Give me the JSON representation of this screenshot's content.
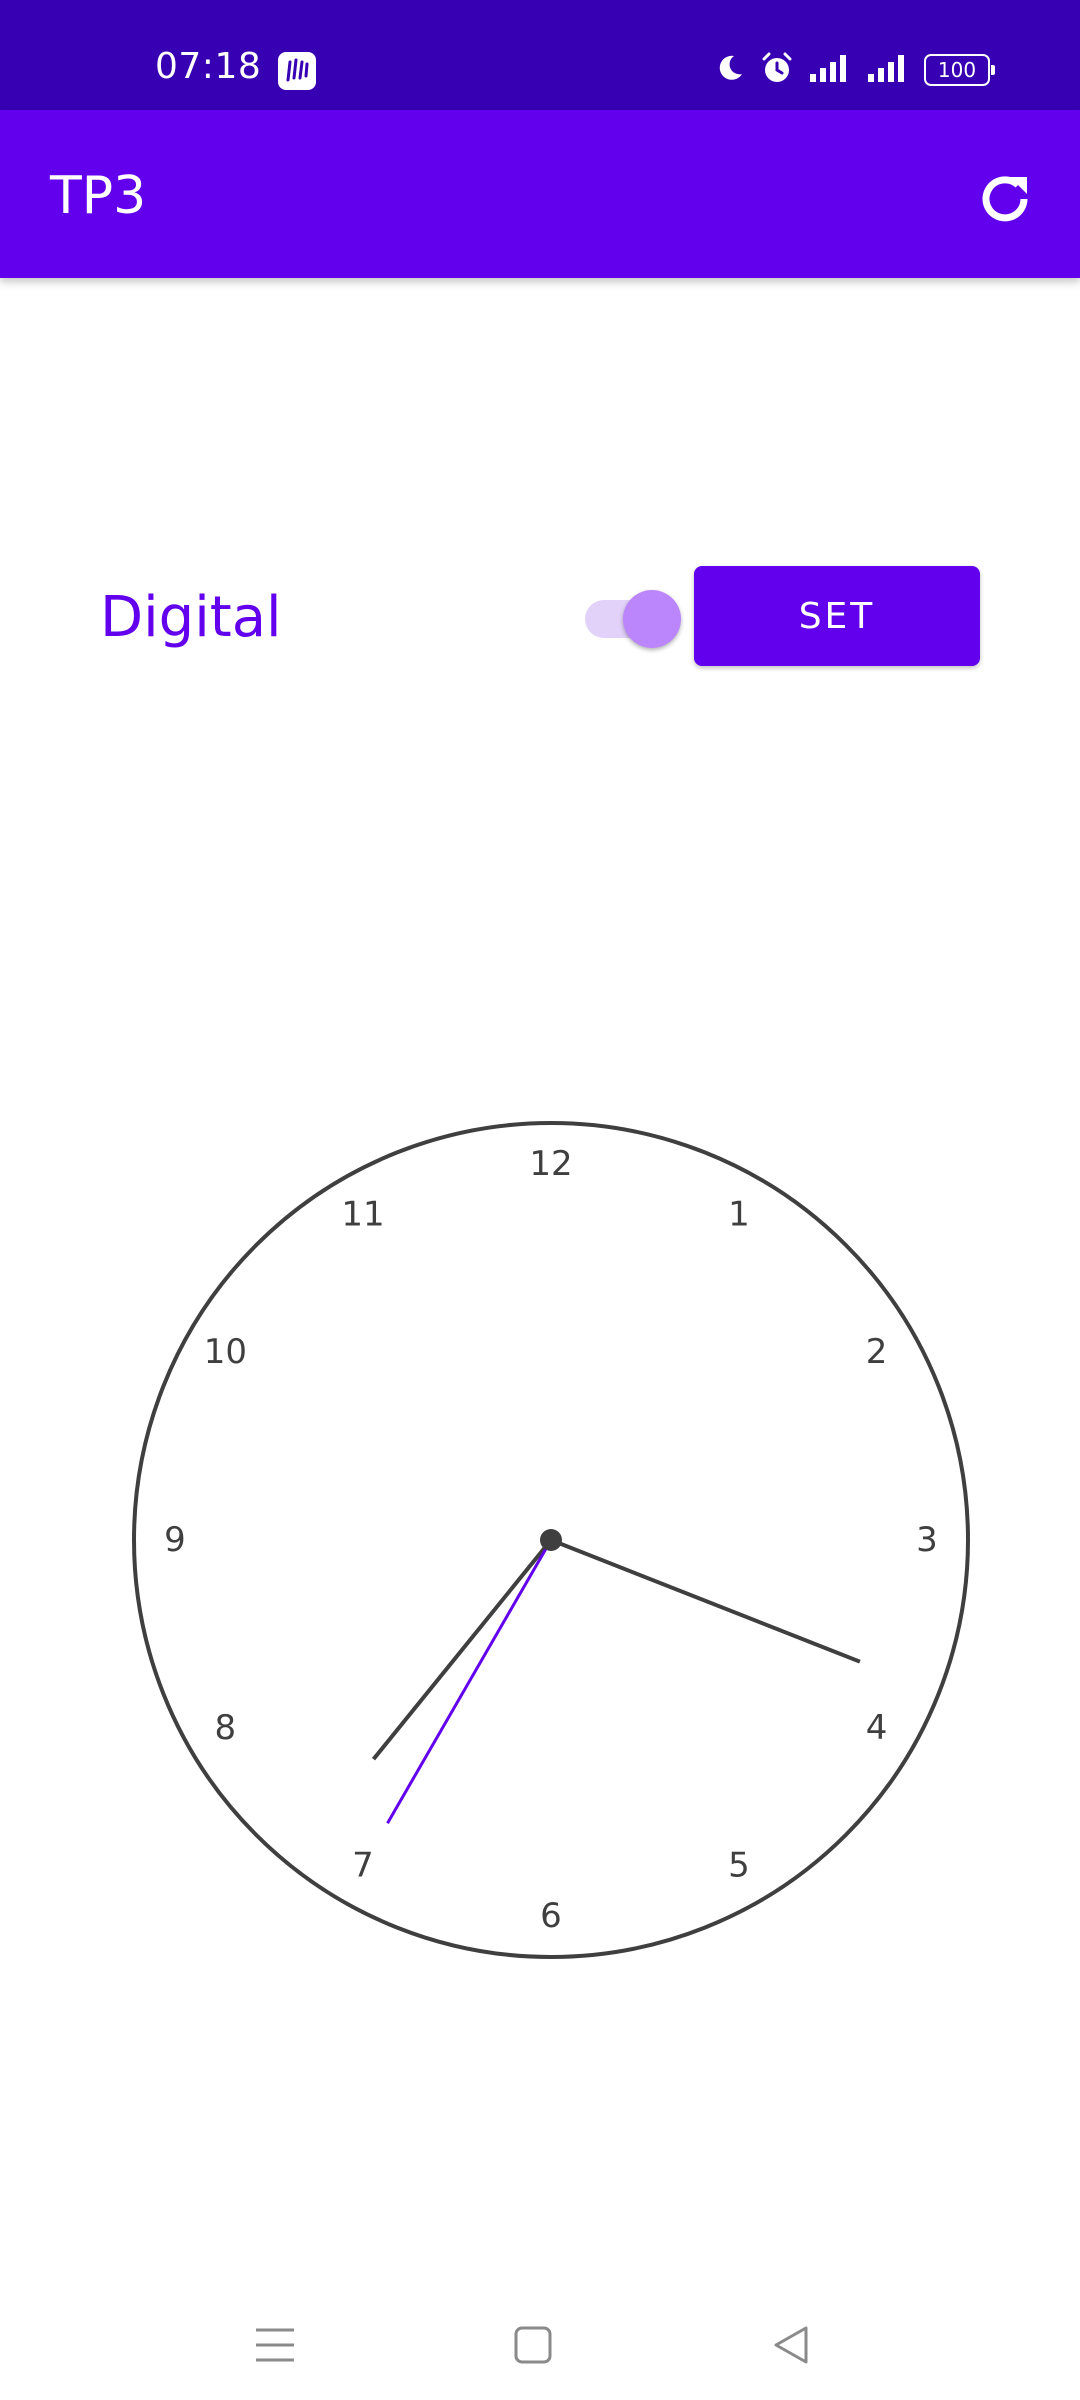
{
  "status_bar": {
    "time": "07:18",
    "app_icon": "notification-app-icon",
    "icons": [
      "moon-icon",
      "alarm-icon",
      "signal-icon",
      "signal-icon"
    ],
    "battery": "100"
  },
  "app_bar": {
    "title": "TP3",
    "refresh_icon": "refresh-icon"
  },
  "controls": {
    "digital_label": "Digital",
    "switch_on": true,
    "set_label": "SET"
  },
  "clock": {
    "numbers": [
      "12",
      "1",
      "2",
      "3",
      "4",
      "5",
      "6",
      "7",
      "8",
      "9",
      "10",
      "11"
    ],
    "time_shown": {
      "hour": 7,
      "minute": 18,
      "second": 35
    }
  },
  "nav_bar": {
    "icons": [
      "menu-icon",
      "home-icon",
      "back-icon"
    ]
  },
  "colors": {
    "status_bar": "#3700b3",
    "primary": "#6200ee",
    "switch_thumb": "#bb86fc",
    "clock_stroke": "#3f3f3f",
    "second_hand": "#6200ee"
  }
}
